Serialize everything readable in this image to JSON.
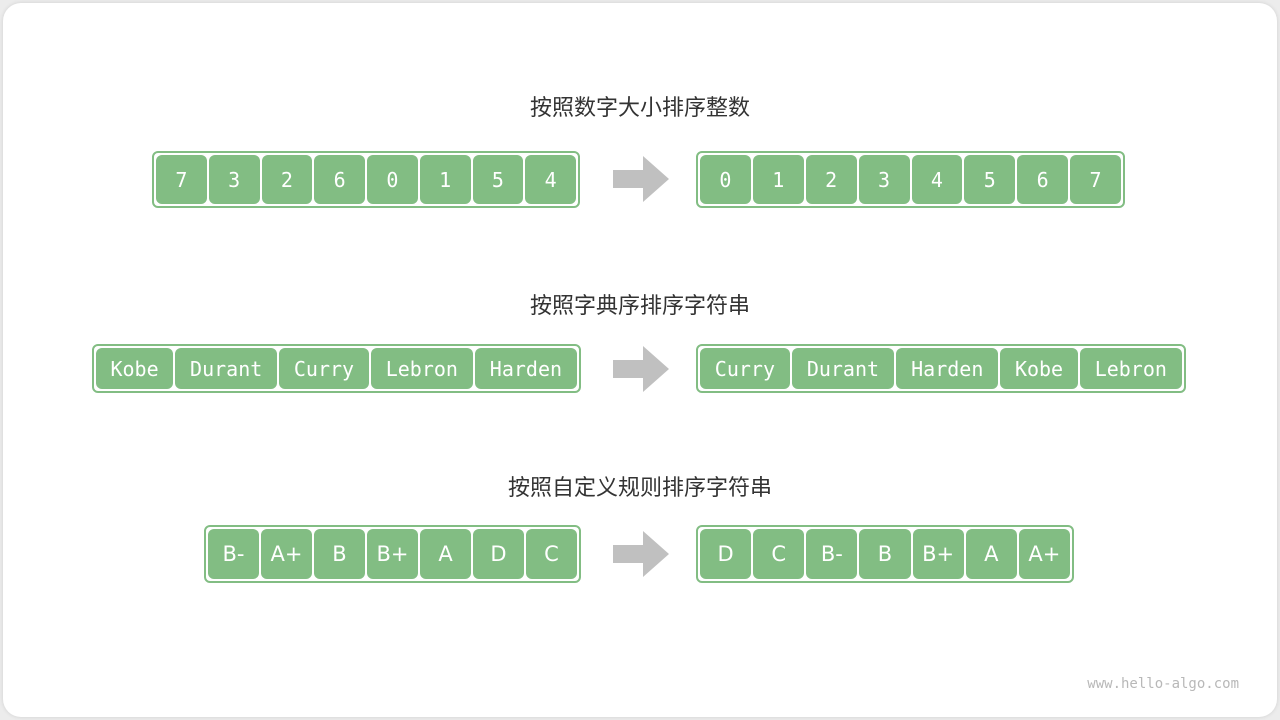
{
  "sections": [
    {
      "title": "按照数字大小排序整数",
      "before": [
        "7",
        "3",
        "2",
        "6",
        "0",
        "1",
        "5",
        "4"
      ],
      "after": [
        "0",
        "1",
        "2",
        "3",
        "4",
        "5",
        "6",
        "7"
      ]
    },
    {
      "title": "按照字典序排序字符串",
      "before": [
        "Kobe",
        "Durant",
        "Curry",
        "Lebron",
        "Harden"
      ],
      "after": [
        "Curry",
        "Durant",
        "Harden",
        "Kobe",
        "Lebron"
      ]
    },
    {
      "title": "按照自定义规则排序字符串",
      "before": [
        "B-",
        "A+",
        "B",
        "B+",
        "A",
        "D",
        "C"
      ],
      "after": [
        "D",
        "C",
        "B-",
        "B",
        "B+",
        "A",
        "A+"
      ]
    }
  ],
  "footer": "www.hello-algo.com",
  "colors": {
    "cell": "#82bd83",
    "arrow": "#c0c0c0",
    "text": "#333333"
  }
}
